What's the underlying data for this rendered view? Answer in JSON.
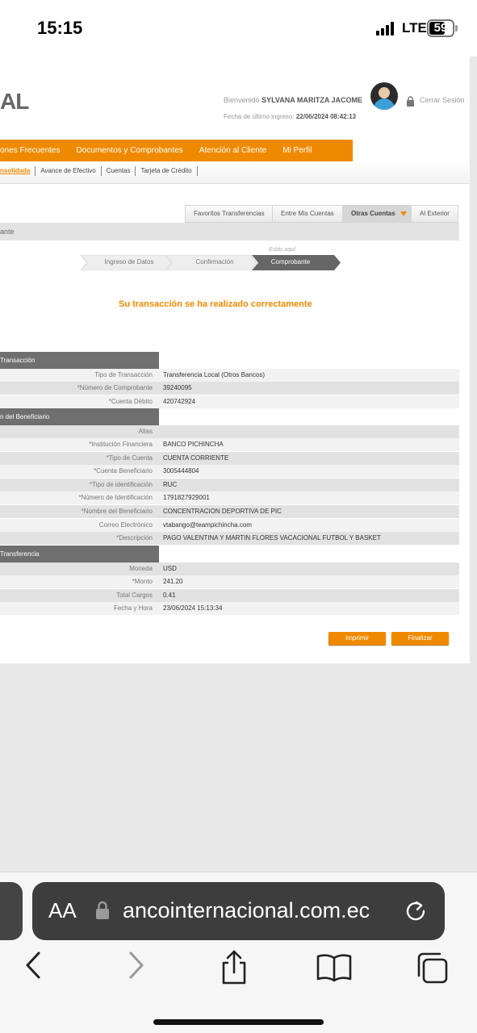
{
  "status_bar": {
    "time": "15:15",
    "network": "LTE",
    "battery": "59"
  },
  "header": {
    "logo_text": "AL",
    "welcome_label": "Bienvenido",
    "user_name": "SYLVANA MARITZA JACOME",
    "last_login_label": "Fecha de último ingreso:",
    "last_login_value": "22/06/2024 08:42:13",
    "logout_label": "Cerrar Sesión"
  },
  "main_nav": [
    "ones Frecuentes",
    "Documentos y Comprobantes",
    "Atención al Cliente",
    "Mi Perfil"
  ],
  "sub_nav": [
    "nsolidada",
    "Avance de Efectivo",
    "Cuentas",
    "Tarjeta de Crédito"
  ],
  "tabs": [
    "Favoritos Transferencias",
    "Entre Mis Cuentas",
    "Otras Cuentas",
    "Al Exterior"
  ],
  "section_title": "ante",
  "steps": {
    "hint": "Estás aquí",
    "items": [
      "Ingreso de Datos",
      "Confirmación",
      "Comprobante"
    ]
  },
  "success_message": "Su transacción se ha realizado correctamente",
  "sections": {
    "transaction": {
      "title": "Transacción",
      "rows": [
        {
          "label": "Tipo de Transacción",
          "value": "Transferencia Local (Otros Bancos)"
        },
        {
          "label": "*Número de Comprobante",
          "value": "39240095"
        },
        {
          "label": "*Cuenta Débito",
          "value": "420742924"
        }
      ]
    },
    "beneficiary": {
      "title": "n del Beneficiario",
      "rows": [
        {
          "label": "Alias",
          "value": ""
        },
        {
          "label": "*Institución Financiera",
          "value": "BANCO PICHINCHA"
        },
        {
          "label": "*Tipo de Cuenta",
          "value": "CUENTA CORRIENTE"
        },
        {
          "label": "*Cuenta Beneficiario",
          "value": "3005444804"
        },
        {
          "label": "*Tipo de identificación",
          "value": "RUC"
        },
        {
          "label": "*Número de Identificación",
          "value": "1791827929001"
        },
        {
          "label": "*Nombre del Beneficiario",
          "value": "CONCENTRACION DEPORTIVA DE PIC"
        },
        {
          "label": "Correo Electrónico",
          "value": "vtabango@teampichincha.com"
        },
        {
          "label": "*Descripción",
          "value": "PAGO VALENTINA Y MARTIN FLORES VACACIONAL FUTBOL Y BASKET"
        }
      ]
    },
    "transfer": {
      "title": "Transferencia",
      "rows": [
        {
          "label": "Moneda",
          "value": "USD"
        },
        {
          "label": "*Monto",
          "value": "241.20"
        },
        {
          "label": "Total Cargos",
          "value": "0.41"
        },
        {
          "label": "Fecha y Hora",
          "value": "23/06/2024 15:13:34"
        }
      ]
    }
  },
  "buttons": {
    "print": "Imprimir",
    "finish": "Finalizar"
  },
  "browser": {
    "aa": "AA",
    "url": "ancointernacional.com.ec"
  },
  "colors": {
    "accent": "#ef8a00",
    "section_header": "#6f6f6f"
  }
}
